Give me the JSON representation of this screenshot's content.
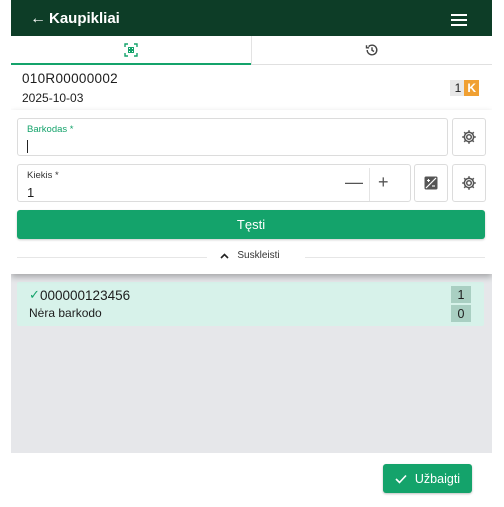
{
  "header": {
    "back_label": "Kaupikliai",
    "back_icon": "arrow-left-icon",
    "menu_icon": "hamburger-menu-icon"
  },
  "tabs": [
    {
      "icon": "barcode-scan-icon",
      "active": true
    },
    {
      "icon": "history-icon",
      "active": false
    }
  ],
  "document": {
    "id": "010R00000002",
    "date": "2025-10-03",
    "count": "1",
    "badge": "K"
  },
  "form": {
    "barcode": {
      "label": "Barkodas *",
      "value": ""
    },
    "quantity": {
      "label": "Kiekis *",
      "value": "1",
      "minus": "—",
      "plus": "+"
    },
    "submit_label": "Tęsti",
    "collapse_label": "Suskleisti"
  },
  "items": [
    {
      "code": "000000123456",
      "subtitle": "Nėra barkodo",
      "count_top": "1",
      "count_bottom": "0",
      "checked": true
    }
  ],
  "footer": {
    "finish_label": "Užbaigti"
  },
  "colors": {
    "header_bg": "#0d3d27",
    "accent": "#14a36b",
    "badge_k": "#f0a032",
    "item_bg": "#d7f2ea"
  }
}
